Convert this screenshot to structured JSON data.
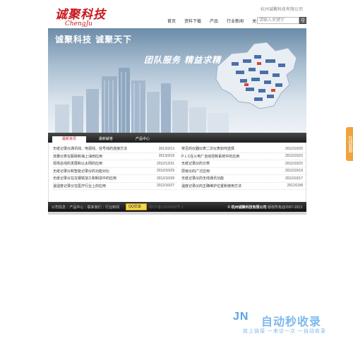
{
  "header": {
    "logo_cn": "诚聚科技",
    "logo_en": "ChengJu",
    "company": "杭州诚聚科技有限公司",
    "nav": [
      "首页",
      "资料下载",
      "产品",
      "行业新闻",
      "关于我们"
    ],
    "search_placeholder": "请输入关键字",
    "search_button": "Q"
  },
  "banner": {
    "title": "诚聚科技  诚聚天下",
    "slogan": "团队服务  精益求精"
  },
  "tabs": [
    "最新资讯",
    "最新解答",
    "产品中心"
  ],
  "news_left": [
    {
      "title": "无纸记录仪通讯线、电源线、信号线的连接方法",
      "date": "2013/3/13"
    },
    {
      "title": "流量仪表在脱硫和海上油田应用",
      "date": "2013/3/18"
    },
    {
      "title": "现场总线的发展和以太网的应用",
      "date": "2012/12/31"
    },
    {
      "title": "无纸记录仪和智能记录仪的功能对比",
      "date": "2012/10/29"
    },
    {
      "title": "无纸记录仪在在钢铁加工和制造中的应用",
      "date": "2012/10/28"
    },
    {
      "title": "温湿度记录仪在医疗行业上的应用",
      "date": "2012/10/27"
    }
  ],
  "news_right": [
    {
      "title": "常见的仪器仪表二次仪表如何选择",
      "date": "2012/10/25"
    },
    {
      "title": "P L C在火电厂自动控制系统中的应用",
      "date": "2012/10/22"
    },
    {
      "title": "无纸记录仪的分类",
      "date": "2012/10/22"
    },
    {
      "title": "层级仪的广泛应用",
      "date": "2012/10/19"
    },
    {
      "title": "无纸记录仪的无线通讯功能",
      "date": "2012/10/17"
    },
    {
      "title": "温度记录仪的正确维护位置和使用方法",
      "date": "2012/10/8"
    }
  ],
  "footer": {
    "links": [
      "公司信息",
      "产品中心",
      "联系我们",
      "行业新闻"
    ],
    "qq_label": "QQ交谈",
    "icp": "浙ICP备11004958号-1",
    "copyright_company": "© 杭州诚聚科技有限公司",
    "copyright_years": "版权所有@2007-2013"
  },
  "float_label": "在线客服",
  "watermark": {
    "logo": "JN",
    "title": "自动秒收录",
    "subtitle": "放上链接 一来访一次 一自动收录"
  },
  "colors": {
    "brand_red": "#c8161d",
    "bar_dark": "#1c1c1c",
    "float_orange": "#f0a33a",
    "watermark_blue": "#7fb8ee"
  }
}
